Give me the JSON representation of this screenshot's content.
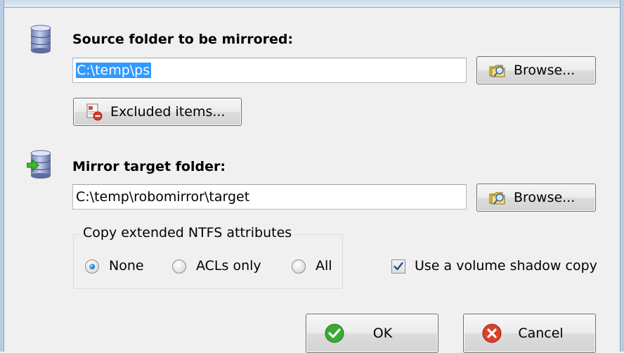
{
  "source": {
    "heading": "Source folder to be mirrored:",
    "path_value": "C:\\temp\\ps",
    "browse_label": "Browse...",
    "excluded_label": "Excluded items..."
  },
  "target": {
    "heading": "Mirror target folder:",
    "path_value": "C:\\temp\\robomirror\\target",
    "browse_label": "Browse..."
  },
  "ntfs": {
    "legend": "Copy extended NTFS attributes",
    "options": [
      "None",
      "ACLs only",
      "All"
    ],
    "selected": "None"
  },
  "shadow_copy": {
    "label": "Use a volume shadow copy",
    "checked": true
  },
  "footer": {
    "ok_label": "OK",
    "cancel_label": "Cancel"
  },
  "colors": {
    "dialog_bg": "#f0f0f0",
    "selection": "#3399ff",
    "ok_green": "#3aa935",
    "cancel_red": "#d9412b"
  }
}
